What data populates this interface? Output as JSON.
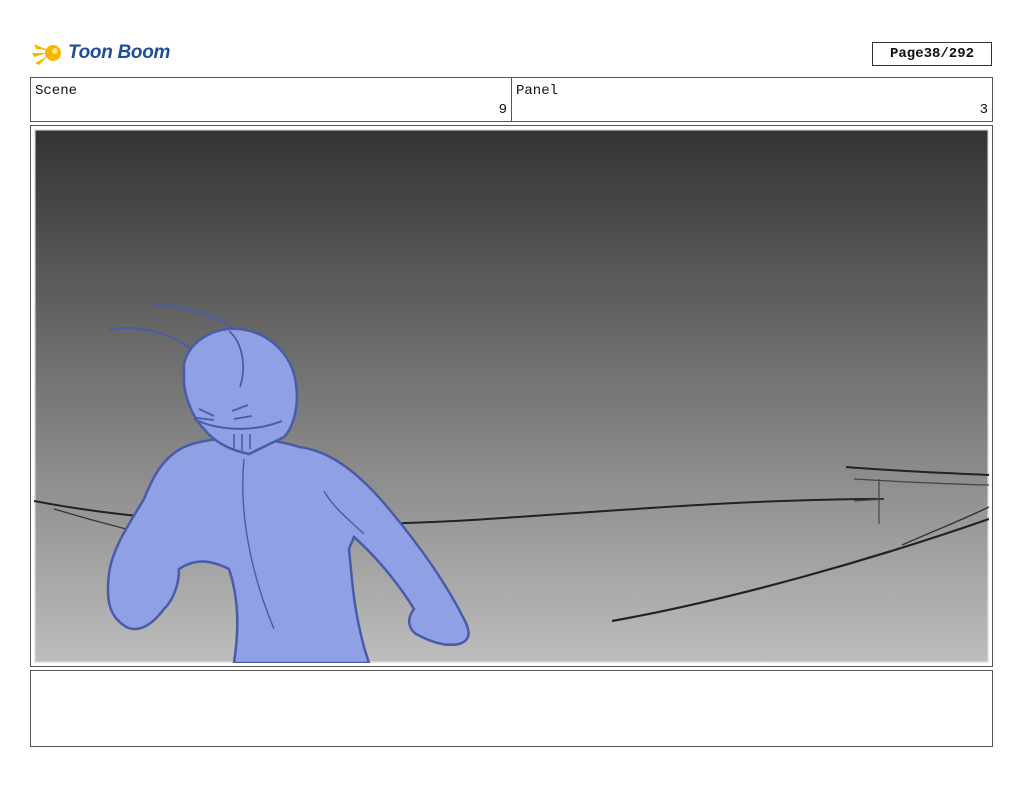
{
  "header": {
    "logo_text": "Toon Boom",
    "page_label": "Page",
    "page_value": "38/292"
  },
  "info": {
    "scene_label": "Scene",
    "scene_value": "9",
    "panel_label": "Panel",
    "panel_value": "3"
  },
  "colors": {
    "logo_blue": "#1f4e9b",
    "logo_yellow": "#f5b800",
    "character_fill": "#8fa0e4",
    "character_stroke": "#4a5ba8",
    "sky_top": "#333333",
    "sky_bottom": "#bdbdbd"
  }
}
